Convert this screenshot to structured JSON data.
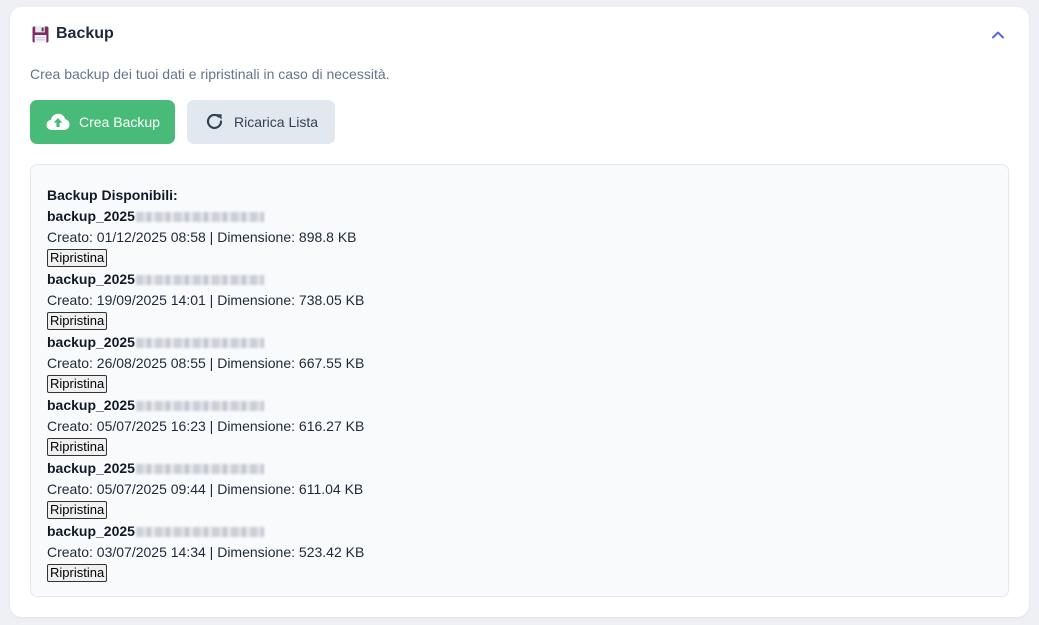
{
  "header": {
    "title": "Backup",
    "icon": "floppy-disk-icon",
    "collapse_icon": "chevron-up-icon"
  },
  "subtitle": "Crea backup dei tuoi dati e ripristinali in caso di necessità.",
  "buttons": {
    "create_label": "Crea Backup",
    "reload_label": "Ricarica Lista"
  },
  "list": {
    "title": "Backup Disponibili:",
    "restore_label": "Ripristina",
    "items": [
      {
        "name": "backup_2025",
        "info": "Creato: 01/12/2025 08:58 | Dimensione: 898.8 KB"
      },
      {
        "name": "backup_2025",
        "info": "Creato: 19/09/2025 14:01 | Dimensione: 738.05 KB"
      },
      {
        "name": "backup_2025",
        "info": "Creato: 26/08/2025 08:55 | Dimensione: 667.55 KB"
      },
      {
        "name": "backup_2025",
        "info": "Creato: 05/07/2025 16:23 | Dimensione: 616.27 KB"
      },
      {
        "name": "backup_2025",
        "info": "Creato: 05/07/2025 09:44 | Dimensione: 611.04 KB"
      },
      {
        "name": "backup_2025",
        "info": "Creato: 03/07/2025 14:34 | Dimensione: 523.42 KB"
      }
    ]
  },
  "colors": {
    "create_button": "#48bb78",
    "reload_button": "#e2e8f0",
    "accent": "#5a67d8"
  }
}
